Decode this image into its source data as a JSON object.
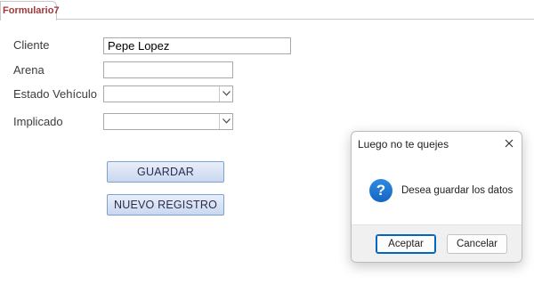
{
  "tab": {
    "label": "Formulario7",
    "accent_color": "#a4373a"
  },
  "form": {
    "cliente": {
      "label": "Cliente",
      "value": "Pepe Lopez"
    },
    "arena": {
      "label": "Arena",
      "value": ""
    },
    "estado_vehiculo": {
      "label": "Estado Vehículo",
      "value": ""
    },
    "implicado": {
      "label": "Implicado",
      "value": ""
    },
    "guardar_label": "GUARDAR",
    "nuevo_registro_label": "NUEVO REGISTRO"
  },
  "dialog": {
    "title": "Luego no te quejes",
    "icon": "question-icon",
    "message": "Desea guardar los datos",
    "accept_label": "Aceptar",
    "cancel_label": "Cancelar",
    "primary_color": "#0067c0"
  }
}
